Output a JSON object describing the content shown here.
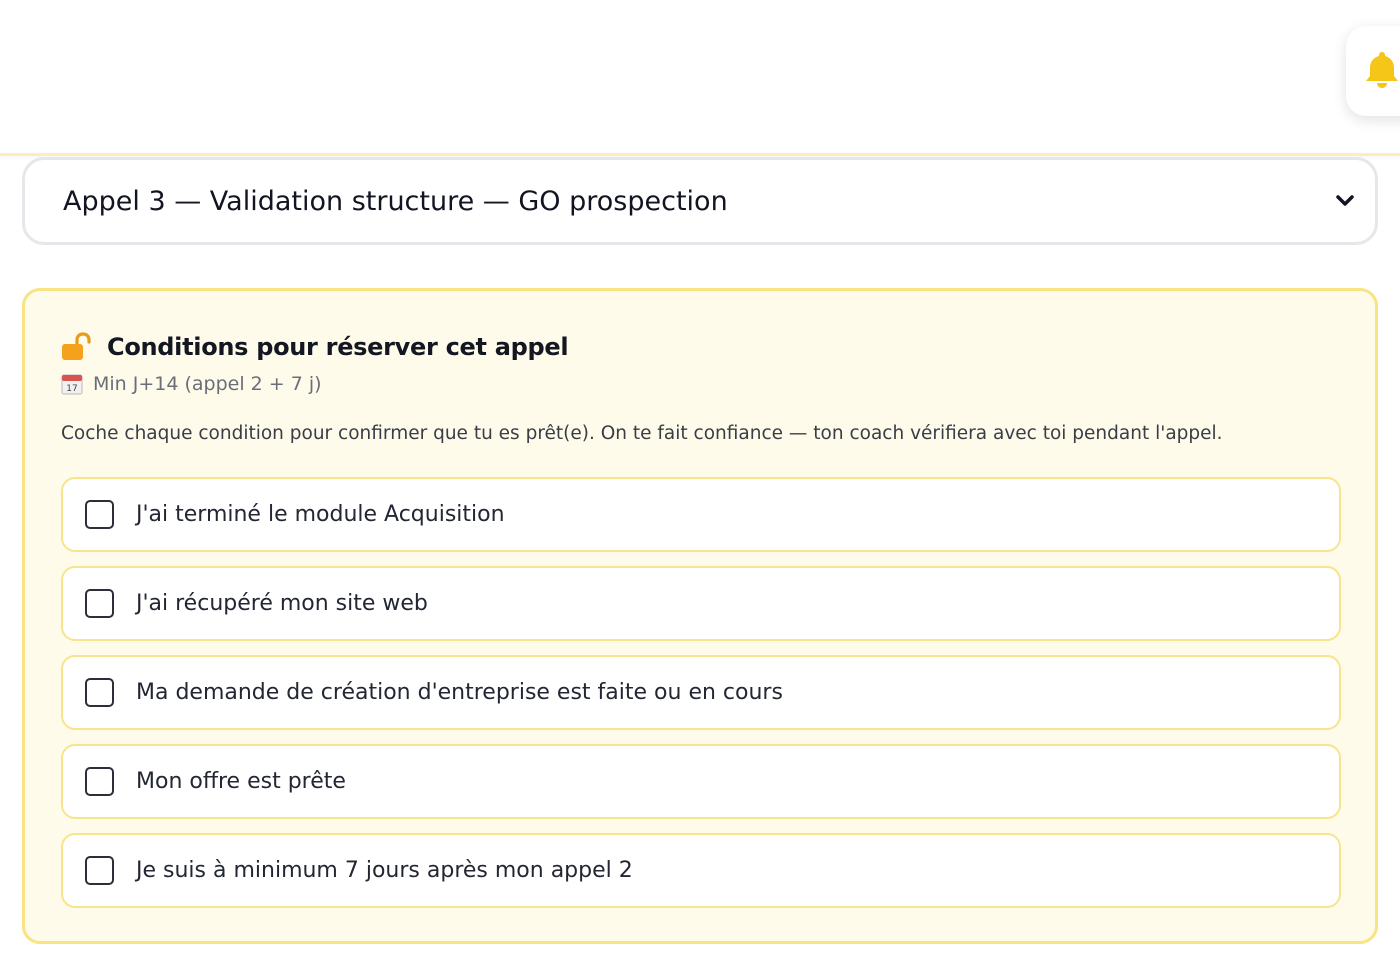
{
  "header": {
    "bell_icon": "bell-icon",
    "accent_color": "#f5c518"
  },
  "call_select": {
    "selected_value": "Appel 3 — Validation structure — GO prospection"
  },
  "conditions_panel": {
    "lock_icon": "unlocked-padlock-icon",
    "title": "Conditions pour réserver cet appel",
    "calendar_icon": "calendar-icon",
    "calendar_date": "17",
    "minimum_delay": "Min J+14 (appel 2 + 7 j)",
    "instructions": "Coche chaque condition pour confirmer que tu es prêt(e). On te fait confiance — ton coach vérifiera avec toi pendant l'appel.",
    "conditions": [
      {
        "label": "J'ai terminé le module Acquisition",
        "checked": false
      },
      {
        "label": "J'ai récupéré mon site web",
        "checked": false
      },
      {
        "label": "Ma demande de création d'entreprise est faite ou en cours",
        "checked": false
      },
      {
        "label": "Mon offre est prête",
        "checked": false
      },
      {
        "label": "Je suis à minimum 7 jours après mon appel 2",
        "checked": false
      }
    ],
    "panel_background": "#fefbea",
    "panel_border": "#f8e483"
  }
}
